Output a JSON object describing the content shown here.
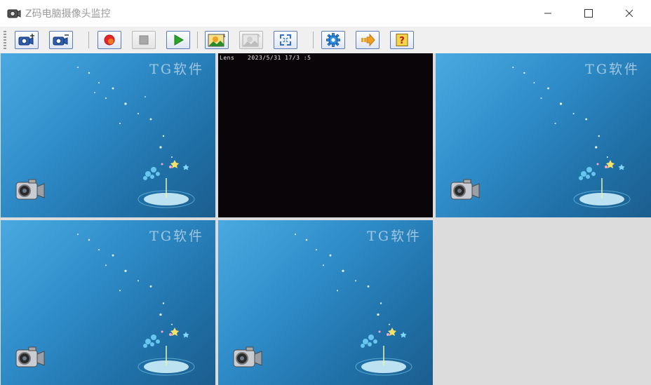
{
  "window": {
    "title": "Z码电脑摄像头监控",
    "controls": [
      "minimize",
      "maximize",
      "close"
    ]
  },
  "toolbar": {
    "buttons": [
      {
        "name": "add-camera-button",
        "icon": "camera-plus-icon"
      },
      {
        "name": "remove-camera-button",
        "icon": "camera-minus-icon"
      },
      {
        "name": "record-button",
        "icon": "record-icon"
      },
      {
        "name": "stop-button",
        "icon": "stop-icon",
        "disabled": true
      },
      {
        "name": "play-button",
        "icon": "play-icon"
      },
      {
        "name": "snapshot-1-button",
        "icon": "landscape-1-icon"
      },
      {
        "name": "snapshot-n-button",
        "icon": "landscape-n-icon",
        "disabled": true
      },
      {
        "name": "fullscreen-button",
        "icon": "fullscreen-icon"
      },
      {
        "name": "settings-button",
        "icon": "gear-icon"
      },
      {
        "name": "exit-button",
        "icon": "arrow-right-icon"
      },
      {
        "name": "help-button",
        "icon": "question-icon"
      }
    ]
  },
  "panes": [
    {
      "type": "placeholder",
      "watermark": "TG软件"
    },
    {
      "type": "live",
      "osd_left": "Lens",
      "osd_right": "2023/5/31 17/3 :5"
    },
    {
      "type": "placeholder",
      "watermark": "TG软件"
    },
    {
      "type": "placeholder",
      "watermark": "TG软件"
    },
    {
      "type": "placeholder",
      "watermark": "TG软件"
    },
    {
      "type": "empty"
    }
  ],
  "colors": {
    "placeholder_bg": "#2f8cc8",
    "live_bg": "#0a0508",
    "empty_bg": "#dcdcdc",
    "record": "#e8242a",
    "play": "#2aa52a"
  }
}
